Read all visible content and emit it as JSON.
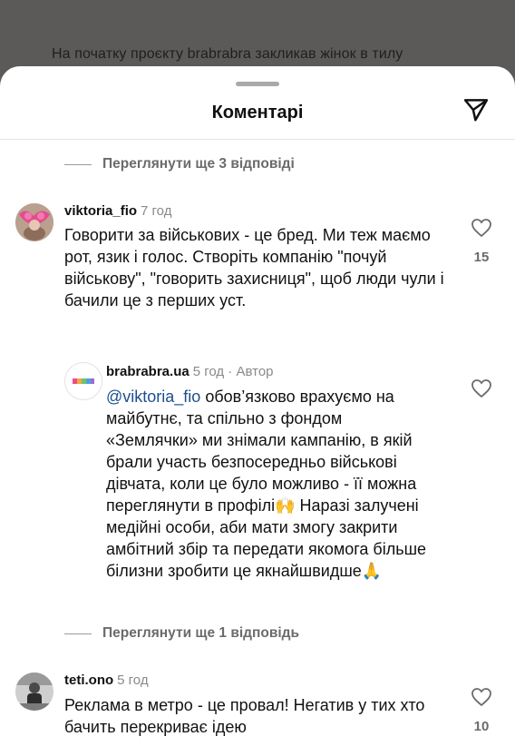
{
  "background": {
    "caption": "На початку проєкту brabrabra закликав жінок в тилу"
  },
  "sheet": {
    "title": "Коментарі",
    "share_icon": "send-icon"
  },
  "threads": {
    "more_replies_1": "Переглянути ще 3 відповіді",
    "more_replies_2": "Переглянути ще 1 відповідь"
  },
  "comments": [
    {
      "user": "viktoria_fio",
      "time": "7 год",
      "text": "Говорити за військових - це бред. Ми теж маємо рот, язик і голос. Створіть компанію \"почуй військову\", \"говорить захисниця\", щоб люди чули і бачили це з перших уст.",
      "likes": "15"
    },
    {
      "user": "brabrabra.ua",
      "time": "5 год",
      "badge": "Автор",
      "mention": "@viktoria_fio",
      "text": "обов’язково врахуємо на майбутнє, та спільно з фондом «Землячки» ми знімали кампанію, в якій брали участь безпосередньо військові дівчата, коли це було можливо - її можна переглянути в профілі🙌 Наразі залучені медійні особи, аби мати змогу закрити амбітний збір та передати якомога більше білизни зробити це якнайшвидше🙏"
    },
    {
      "user": "teti.ono",
      "time": "5 год",
      "text": "Реклама в метро - це провал! Негатив у тих хто бачить перекриває ідею",
      "likes": "10"
    }
  ],
  "colors": {
    "backdrop": "#5b5a58",
    "sheet": "#ffffff",
    "mention": "#1c4f8d",
    "muted": "#8a8a8a"
  }
}
